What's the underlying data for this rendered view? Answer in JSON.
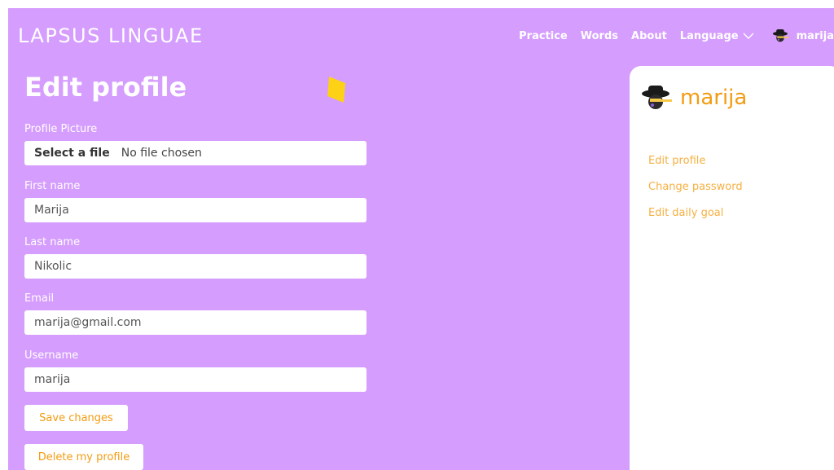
{
  "brand": "LAPSUS LINGUAE",
  "nav": {
    "practice": "Practice",
    "words": "Words",
    "about": "About",
    "language": "Language",
    "user": "marija"
  },
  "page": {
    "title": "Edit profile"
  },
  "form": {
    "profile_picture_label": "Profile Picture",
    "file_button": "Select a file",
    "file_status": "No file chosen",
    "first_name_label": "First name",
    "first_name_value": "Marija",
    "last_name_label": "Last name",
    "last_name_value": "Nikolic",
    "email_label": "Email",
    "email_value": "marija@gmail.com",
    "username_label": "Username",
    "username_value": "marija",
    "save_label": "Save changes",
    "delete_label": "Delete my profile"
  },
  "sidebar": {
    "name": "marija",
    "links": [
      "Edit profile",
      "Change password",
      "Edit daily goal"
    ]
  },
  "colors": {
    "background": "#d59dfe",
    "accent": "#f39c12",
    "link": "#f5b041",
    "card": "#ffffff"
  },
  "icons": {
    "avatar": "hat-man-avatar-icon",
    "language_chevron": "chevron-down-icon",
    "decoration": "yellow-diamond-icon"
  }
}
